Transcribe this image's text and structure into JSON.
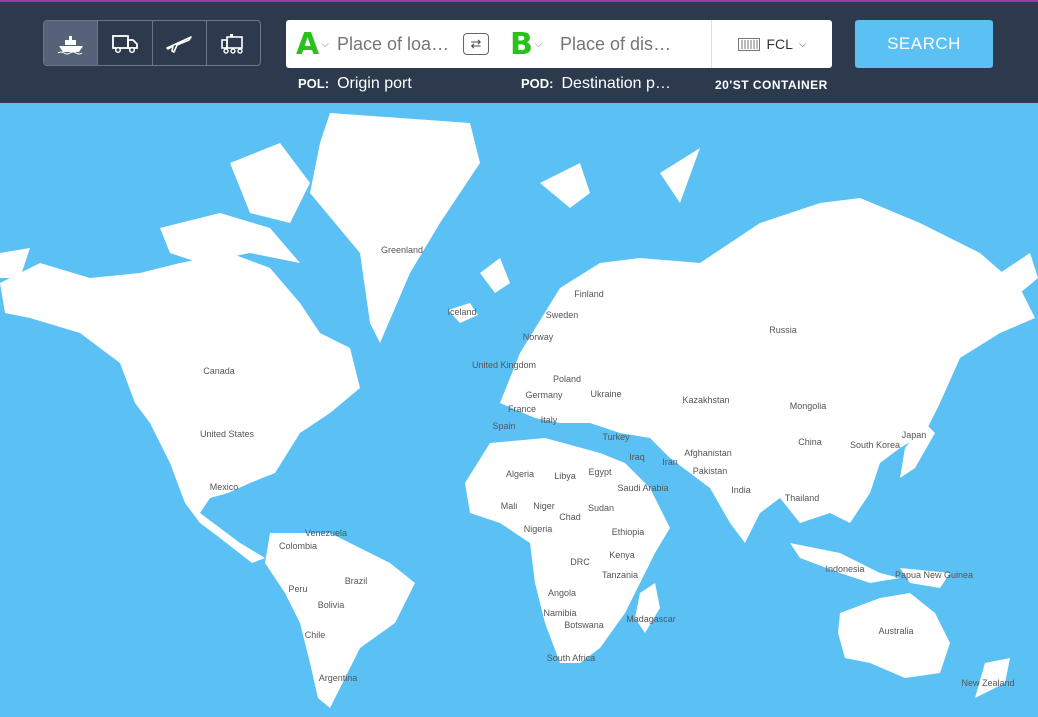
{
  "header": {
    "transport_modes": [
      {
        "name": "sea",
        "active": true
      },
      {
        "name": "truck",
        "active": false
      },
      {
        "name": "air",
        "active": false
      },
      {
        "name": "rail",
        "active": false
      }
    ],
    "origin": {
      "letter": "A",
      "placeholder": "Place of loadi…",
      "caption_prefix": "POL:",
      "caption": "Origin port"
    },
    "destination": {
      "letter": "B",
      "placeholder": "Place of disc…",
      "caption_prefix": "POD:",
      "caption": "Destination p…"
    },
    "load_type": "FCL",
    "container": "20'ST CONTAINER",
    "search_label": "SEARCH"
  },
  "map": {
    "colors": {
      "ocean": "#5bc1f5",
      "land": "#ffffff"
    },
    "labels": [
      "Greenland",
      "Iceland",
      "Finland",
      "Sweden",
      "Norway",
      "United Kingdom",
      "Poland",
      "Germany",
      "Ukraine",
      "France",
      "Spain",
      "Italy",
      "Turkey",
      "Russia",
      "Kazakhstan",
      "Mongolia",
      "China",
      "South Korea",
      "Japan",
      "Afghanistan",
      "Iraq",
      "Iran",
      "Pakistan",
      "India",
      "Thailand",
      "Indonesia",
      "Papua New Guinea",
      "Australia",
      "New Zealand",
      "Canada",
      "United States",
      "Mexico",
      "Venezuela",
      "Colombia",
      "Brazil",
      "Peru",
      "Bolivia",
      "Chile",
      "Argentina",
      "Algeria",
      "Libya",
      "Egypt",
      "Saudi Arabia",
      "Mali",
      "Niger",
      "Chad",
      "Sudan",
      "Nigeria",
      "Ethiopia",
      "Kenya",
      "DRC",
      "Tanzania",
      "Angola",
      "Namibia",
      "Botswana",
      "Madagascar",
      "South Africa"
    ]
  }
}
